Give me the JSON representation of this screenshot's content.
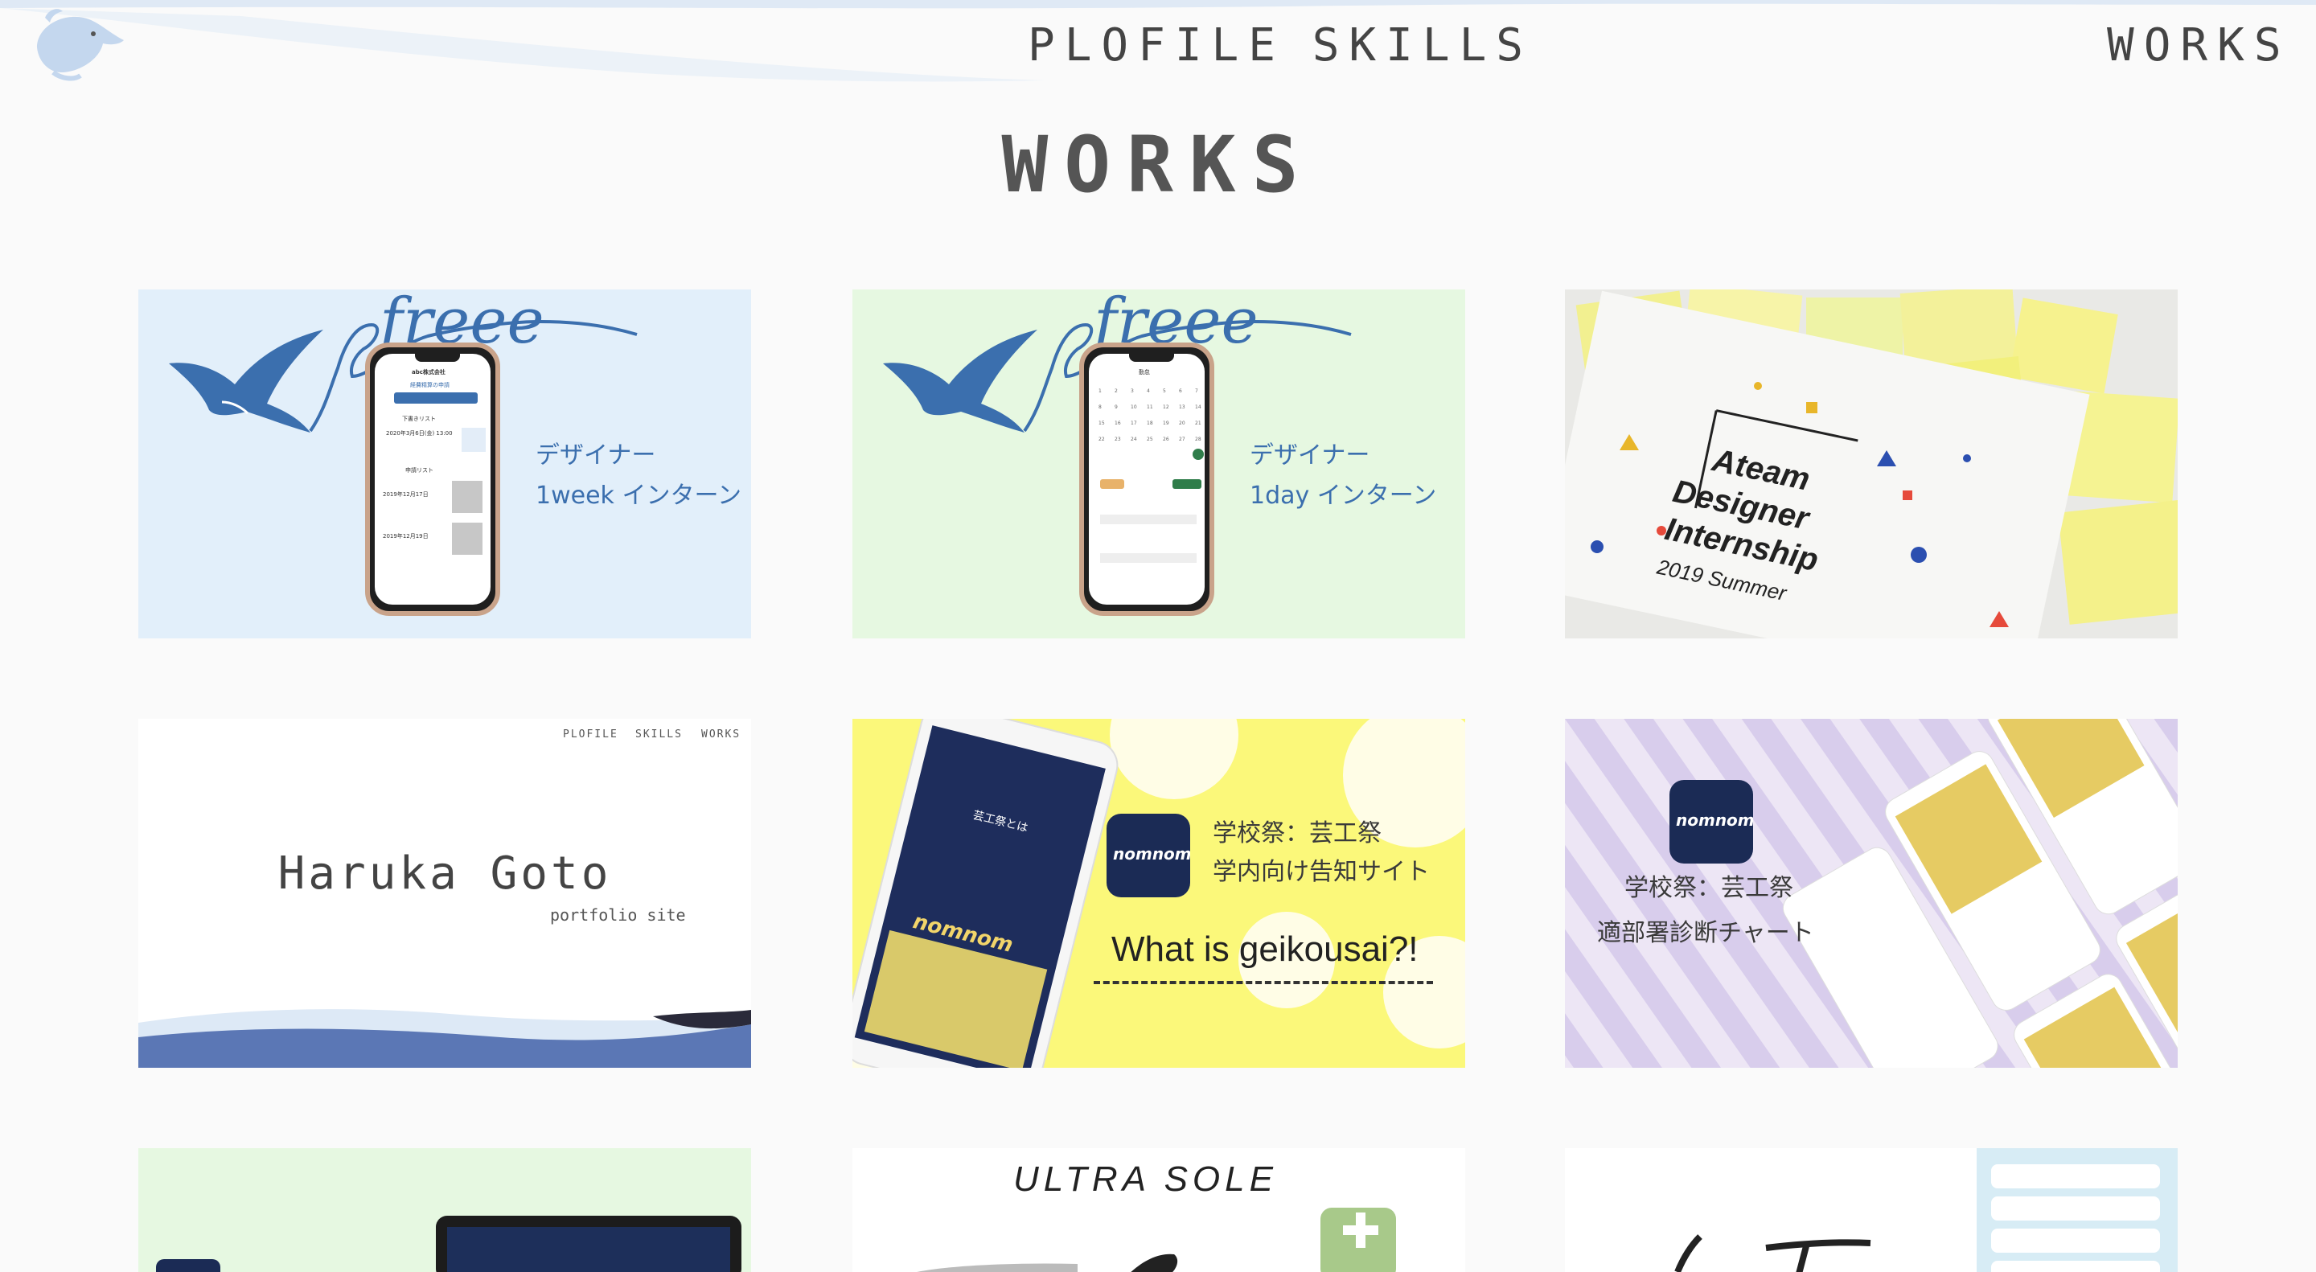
{
  "header": {
    "logo_icon": "whale-icon",
    "nav": [
      {
        "label": "PLOFILE"
      },
      {
        "label": "SKILLS"
      },
      {
        "label": "WORKS"
      }
    ]
  },
  "page": {
    "title": "WORKS"
  },
  "cards": [
    {
      "lines": [
        "デザイナー",
        "1week インターン"
      ],
      "logo_text": "freee",
      "bg": "#e2effa"
    },
    {
      "lines": [
        "デザイナー",
        "1day インターン"
      ],
      "logo_text": "freee",
      "bg": "#e6f8e1"
    },
    {
      "lines": [
        "Ateam",
        "Designer",
        "Internship",
        "2019 Summer"
      ],
      "bg": "#f0f0ee"
    },
    {
      "name": "Haruka Goto",
      "sub": "portfolio site",
      "nav": [
        "PLOFILE",
        "SKILLS",
        "WORKS"
      ],
      "bg": "#ffffff"
    },
    {
      "lines": [
        "学校祭：芸工祭",
        "学内向け告知サイト"
      ],
      "tagline": "What is geikousai?!",
      "app_name": "nomnom",
      "bg": "#fbf87a"
    },
    {
      "lines": [
        "学校祭：芸工祭",
        "適部署診断チャート"
      ],
      "app_name": "nomnom",
      "bg": "#ede6f5"
    },
    {
      "bg": "#e6f8e1"
    },
    {
      "title": "ULTRA SOLE",
      "bg": "#ffffff"
    },
    {
      "bg": "#ffffff"
    }
  ]
}
